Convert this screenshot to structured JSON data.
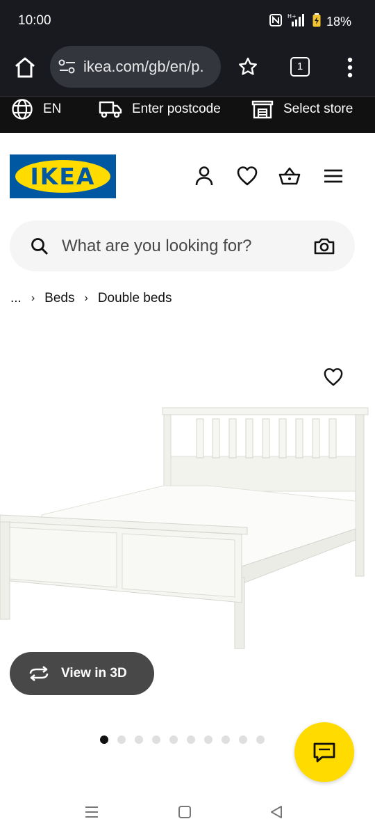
{
  "status_bar": {
    "time": "10:00",
    "battery": "18%",
    "network": "H+"
  },
  "browser": {
    "url": "ikea.com/gb/en/p.",
    "tab_count": "1"
  },
  "util_bar": {
    "language": "EN",
    "postcode": "Enter postcode",
    "store": "Select store"
  },
  "brand": {
    "logo_text": "IKEA",
    "blue": "#0058a3",
    "yellow": "#ffdb00"
  },
  "header_icons": [
    "person-icon",
    "heart-icon",
    "basket-icon",
    "menu-icon"
  ],
  "search": {
    "placeholder": "What are you looking for?"
  },
  "breadcrumb": {
    "ellipsis": "...",
    "items": [
      "Beds",
      "Double beds"
    ]
  },
  "product": {
    "view_3d_label": "View in 3D"
  },
  "carousel": {
    "total_images": 10,
    "active_index": 0
  }
}
